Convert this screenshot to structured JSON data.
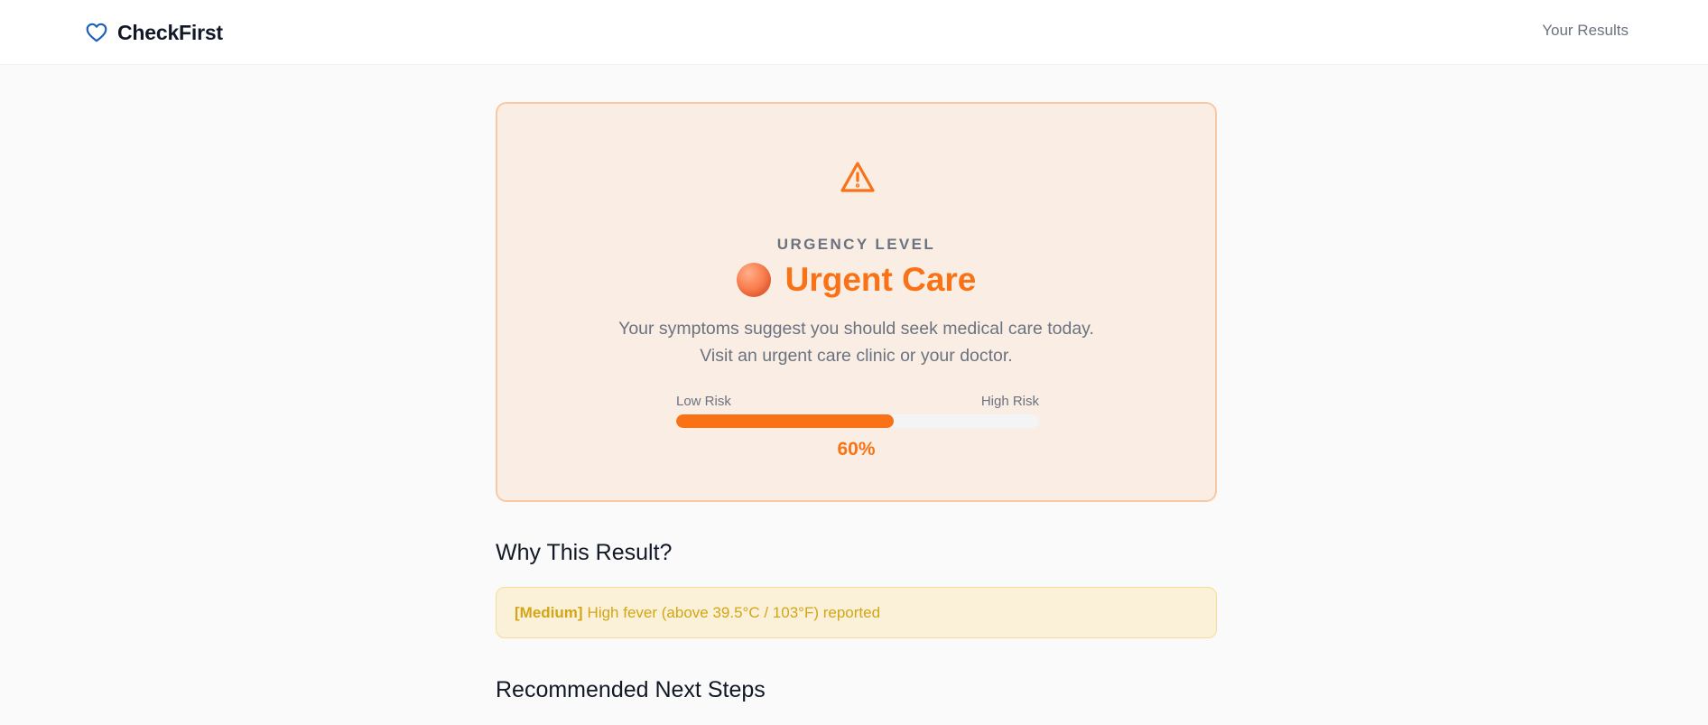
{
  "header": {
    "brand": "CheckFirst",
    "brand_icon": "heart-icon",
    "nav_link": "Your Results"
  },
  "result": {
    "icon": "warning-triangle-icon",
    "urgency_label": "URGENCY LEVEL",
    "level": "Urgent Care",
    "description_line1": "Your symptoms suggest you should seek medical care today.",
    "description_line2": "Visit an urgent care clinic or your doctor.",
    "risk_low_label": "Low Risk",
    "risk_high_label": "High Risk",
    "risk_fraction": 0.6,
    "risk_percent_text": "60%",
    "accent_color": "#f97316"
  },
  "why": {
    "title": "Why This Result?",
    "reasons": [
      {
        "tag": "[Medium]",
        "text": "High fever (above 39.5°C / 103°F) reported"
      }
    ]
  },
  "next_steps": {
    "title": "Recommended Next Steps"
  }
}
